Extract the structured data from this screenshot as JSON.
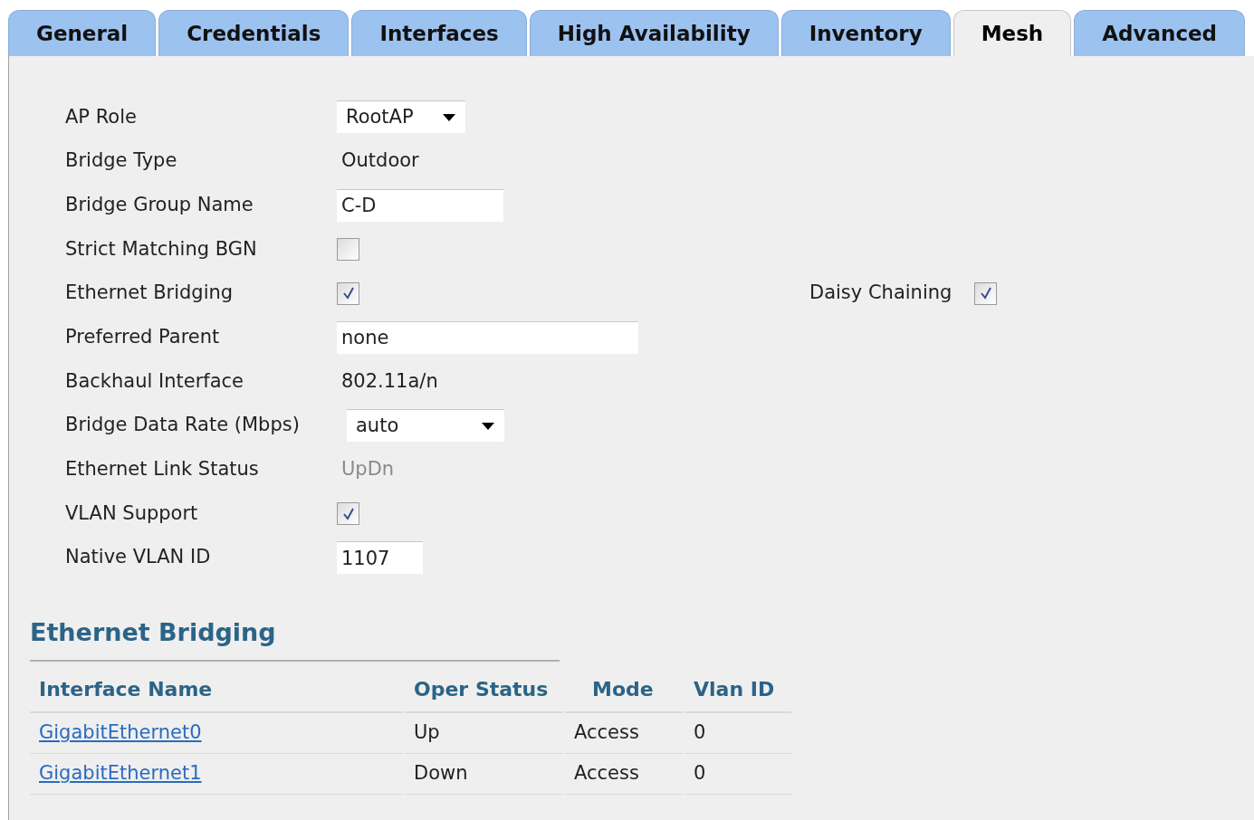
{
  "tabs": [
    {
      "label": "General",
      "selected": false
    },
    {
      "label": "Credentials",
      "selected": false
    },
    {
      "label": "Interfaces",
      "selected": false
    },
    {
      "label": "High Availability",
      "selected": false
    },
    {
      "label": "Inventory",
      "selected": false
    },
    {
      "label": "Mesh",
      "selected": true
    },
    {
      "label": "Advanced",
      "selected": false
    }
  ],
  "fields": [
    {
      "label": "AP Role",
      "kind": "select",
      "value": "RootAP"
    },
    {
      "label": "Bridge Type",
      "kind": "text",
      "value": "Outdoor"
    },
    {
      "label": "Bridge Group Name",
      "kind": "input",
      "value": "C-D"
    },
    {
      "label": "Strict Matching BGN",
      "kind": "checkbox",
      "checked": false
    },
    {
      "label": "Ethernet Bridging",
      "kind": "checkbox",
      "checked": true,
      "side": {
        "label": "Daisy Chaining",
        "checked": true
      }
    },
    {
      "label": "Preferred Parent",
      "kind": "input",
      "value": "none"
    },
    {
      "label": "Backhaul Interface",
      "kind": "text",
      "value": "802.11a/n"
    },
    {
      "label": "Bridge Data Rate (Mbps)",
      "kind": "select",
      "value": "auto"
    },
    {
      "label": "Ethernet Link Status",
      "kind": "readonly",
      "value": "UpDn"
    },
    {
      "label": "VLAN Support",
      "kind": "checkbox",
      "checked": true
    },
    {
      "label": "Native VLAN ID",
      "kind": "input",
      "value": "1107"
    }
  ],
  "ethernet_bridging": {
    "title": "Ethernet Bridging",
    "columns": [
      "Interface Name",
      "Oper Status",
      "Mode",
      "Vlan ID"
    ],
    "rows": [
      {
        "cells": [
          "GigabitEthernet0",
          "Up",
          "Access",
          "0"
        ]
      },
      {
        "cells": [
          "GigabitEthernet1",
          "Down",
          "Access",
          "0"
        ]
      }
    ]
  }
}
